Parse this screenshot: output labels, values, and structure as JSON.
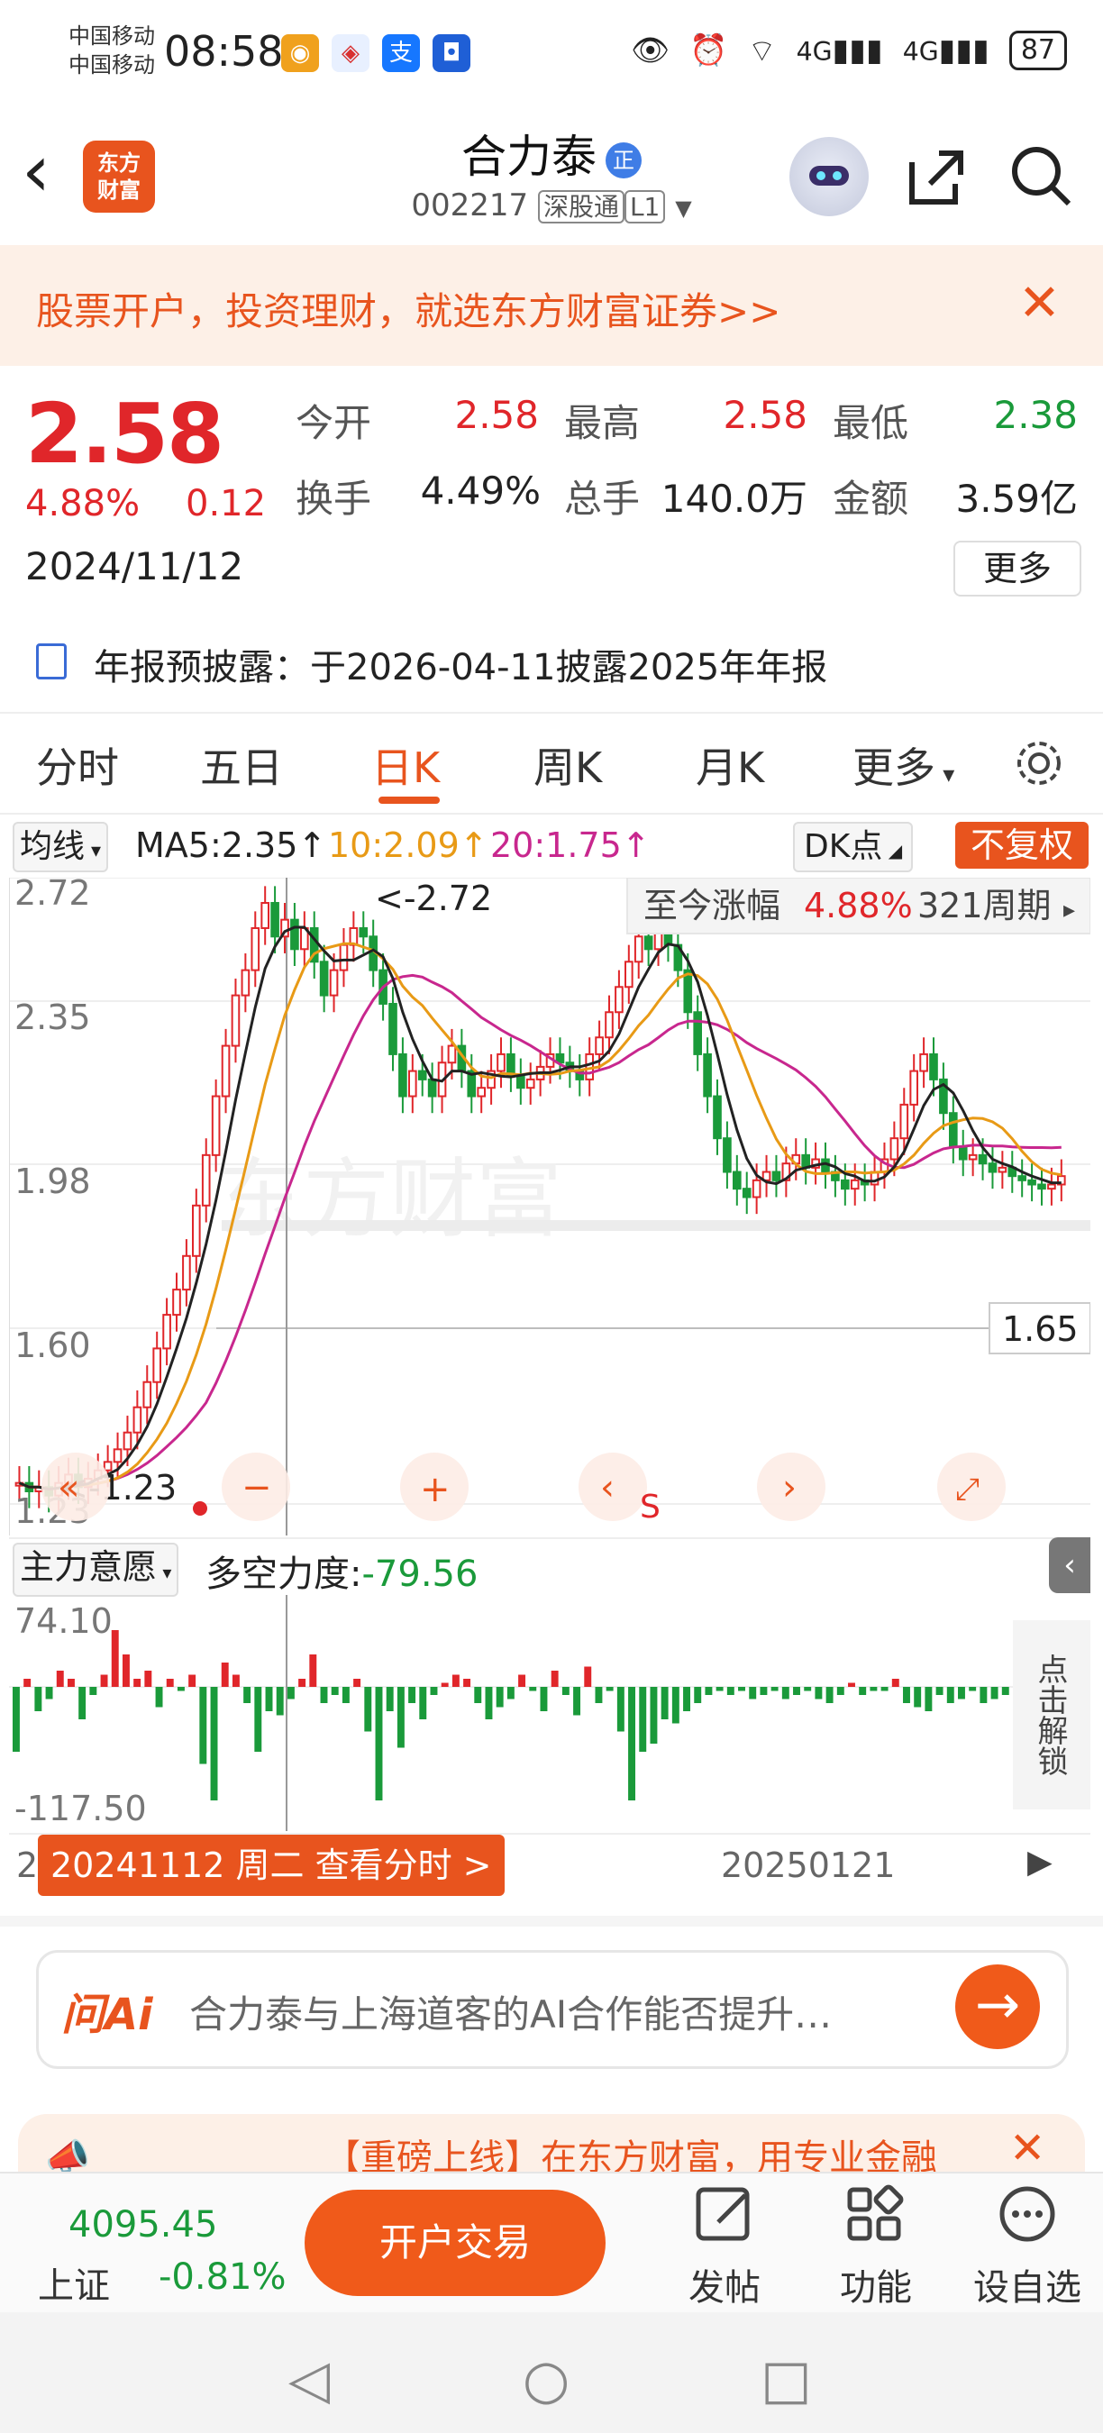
{
  "status_bar": {
    "carrier1": "中国移动",
    "carrier2": "中国移动",
    "time": "08:58",
    "signal": "4G",
    "signal2": "4G",
    "battery": "87"
  },
  "header": {
    "logo": "东方\n财富",
    "title": "合力泰",
    "title_badge": "正",
    "code": "002217",
    "tag1": "深股通",
    "tag2": "L1"
  },
  "promo": {
    "text": "股票开户，投资理财，就选东方财富证券>>"
  },
  "quote": {
    "price": "2.58",
    "change_pct": "4.88%",
    "change": "0.12",
    "date": "2024/11/12",
    "stats": [
      {
        "label": "今开",
        "value": "2.58",
        "color": "#e0262a"
      },
      {
        "label": "最高",
        "value": "2.58",
        "color": "#e0262a"
      },
      {
        "label": "最低",
        "value": "2.38",
        "color": "#1a9a3a"
      },
      {
        "label": "换手",
        "value": "4.49%",
        "color": "#222"
      },
      {
        "label": "总手",
        "value": "140.0万",
        "color": "#222"
      },
      {
        "label": "金额",
        "value": "3.59亿",
        "color": "#222"
      }
    ],
    "more": "更多"
  },
  "notice": {
    "text": "年报预披露：于2026-04-11披露2025年年报"
  },
  "tabs": [
    "分时",
    "五日",
    "日K",
    "周K",
    "月K",
    "更多"
  ],
  "active_tab": "日K",
  "indicator_bar": {
    "ma_select": "均线",
    "ma5": "MA5:2.35↑",
    "ma10": "10:2.09↑",
    "ma20": "20:1.75↑",
    "dk": "DK点",
    "fq": "不复权"
  },
  "main_chart": {
    "y_ticks": [
      "2.72",
      "2.35",
      "1.98",
      "1.60",
      "1.23"
    ],
    "high_label": "<-2.72",
    "low_label": "<-1.23",
    "price_tag": "1.65",
    "summary_label": "至今涨幅",
    "summary_pct": "4.88%",
    "summary_period": "321周期",
    "watermark": "东方财富",
    "sell_mark": "S"
  },
  "sub_chart": {
    "select": "主力意愿",
    "label": "多空力度:",
    "value": "-79.56",
    "top": "74.10",
    "bottom": "-117.50",
    "unlock": "点击解锁"
  },
  "x_axis": {
    "left": "2",
    "date_pill": "20241112 周二 查看分时 >",
    "mid": "20250121"
  },
  "ai": {
    "logo": "问Ai",
    "placeholder": "合力泰与上海道客的AI合作能否提升…"
  },
  "banner": {
    "text": "【重磅上线】在东方财富，用专业金融"
  },
  "bottom": {
    "index_value": "4095.45",
    "index_name": "上证",
    "index_change": "-0.81%",
    "trade": "开户交易",
    "items": [
      {
        "icon": "edit-icon",
        "label": "发帖"
      },
      {
        "icon": "grid-icon",
        "label": "功能"
      },
      {
        "icon": "more-icon",
        "label": "设自选"
      }
    ]
  },
  "colors": {
    "up": "#e0262a",
    "down": "#1a9a3a",
    "accent": "#e8541e",
    "ma5": "#222222",
    "ma10": "#e89a16",
    "ma20": "#c8278e"
  },
  "chart_data": {
    "type": "candlestick",
    "title": "",
    "xlabel": "",
    "ylabel": "",
    "ylim": [
      1.23,
      2.72
    ],
    "x": [
      "20241112",
      "20250121"
    ],
    "series": [
      {
        "name": "MA5",
        "last": 2.35
      },
      {
        "name": "10",
        "last": 2.09
      },
      {
        "name": "20",
        "last": 1.75
      }
    ],
    "sub_indicator": {
      "name": "多空力度",
      "last": -79.56,
      "ylim": [
        -117.5,
        74.1
      ]
    }
  }
}
